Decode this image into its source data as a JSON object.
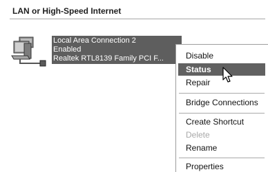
{
  "group": {
    "title": "LAN or High-Speed Internet"
  },
  "connection": {
    "icon": "network-connection-icon",
    "name": "Local Area Connection 2",
    "status": "Enabled",
    "device": "Realtek RTL8139 Family PCI F..."
  },
  "context_menu": {
    "items": [
      {
        "label": "Disable",
        "state": "normal"
      },
      {
        "label": "Status",
        "state": "selected"
      },
      {
        "label": "Repair",
        "state": "normal"
      },
      {
        "label": "Bridge Connections",
        "state": "normal"
      },
      {
        "label": "Create Shortcut",
        "state": "normal"
      },
      {
        "label": "Delete",
        "state": "disabled"
      },
      {
        "label": "Rename",
        "state": "normal"
      },
      {
        "label": "Properties",
        "state": "normal"
      }
    ]
  },
  "colors": {
    "selection": "#5e5e5e",
    "menu_highlight": "#616161",
    "disabled_text": "#a8a8a8"
  },
  "cursor": {
    "icon": "mouse-pointer-icon"
  }
}
